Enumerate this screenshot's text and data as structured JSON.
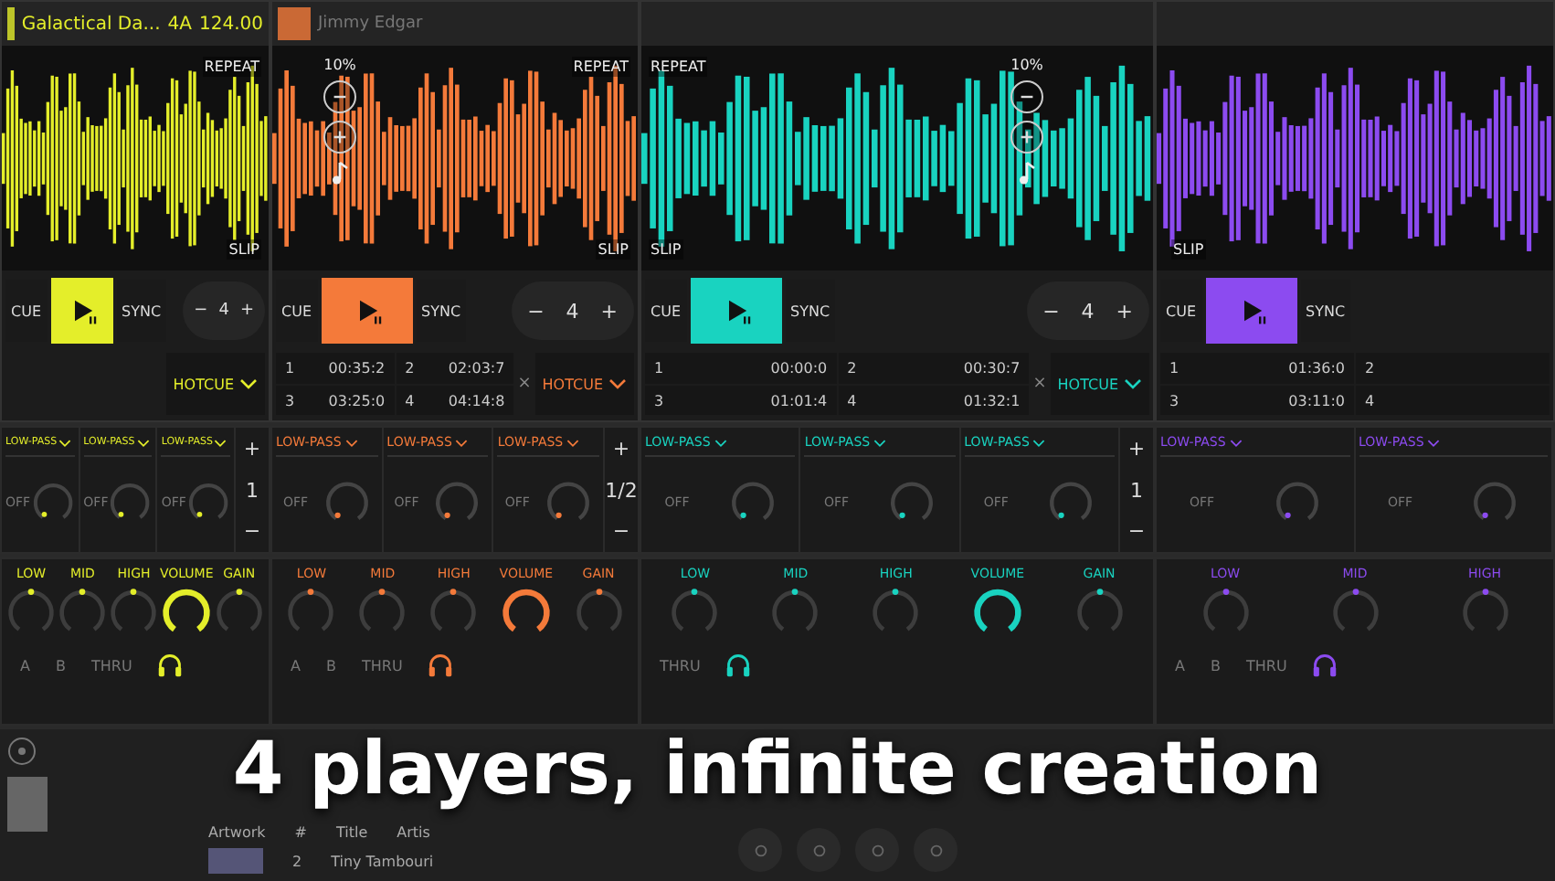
{
  "decks": [
    {
      "color": "#e4ee2a",
      "title": "Galactical Da...",
      "key": "4A",
      "bpm": "124.00",
      "repeat": "REPEAT",
      "slip": "SLIP",
      "cue": "CUE",
      "sync": "SYNC",
      "loop": {
        "minus": "−",
        "beats": "4",
        "plus": "+"
      },
      "hotcue": "HOTCUE"
    },
    {
      "color": "#f47a3a",
      "artist": "Jimmy Edgar",
      "pitch": "10%",
      "repeat": "REPEAT",
      "slip": "SLIP",
      "cue": "CUE",
      "sync": "SYNC",
      "loop": {
        "minus": "−",
        "beats": "4",
        "plus": "+"
      },
      "cues": [
        {
          "num": "1",
          "time": "00:35:2"
        },
        {
          "num": "2",
          "time": "02:03:7"
        },
        {
          "num": "3",
          "time": "03:25:0"
        },
        {
          "num": "4",
          "time": "04:14:8"
        }
      ],
      "clear": "×",
      "hotcue": "HOTCUE"
    },
    {
      "color": "#19d3c0",
      "pitch": "10%",
      "repeat": "REPEAT",
      "slip": "SLIP",
      "cue": "CUE",
      "sync": "SYNC",
      "loop": {
        "minus": "−",
        "beats": "4",
        "plus": "+"
      },
      "cues": [
        {
          "num": "1",
          "time": "00:00:0"
        },
        {
          "num": "2",
          "time": "00:30:7"
        },
        {
          "num": "3",
          "time": "01:01:4"
        },
        {
          "num": "4",
          "time": "01:32:1"
        }
      ],
      "clear": "×",
      "hotcue": "HOTCUE"
    },
    {
      "color": "#8c4bf0",
      "slip": "SLIP",
      "cue": "CUE",
      "sync": "SYNC",
      "cues": [
        {
          "num": "1",
          "time": "01:36:0"
        },
        {
          "num": "2"
        },
        {
          "num": "3",
          "time": "03:11:0"
        },
        {
          "num": "4"
        }
      ]
    }
  ],
  "effects": [
    {
      "units": [
        {
          "name": "LOW-PASS",
          "state": "OFF"
        },
        {
          "name": "LOW-PASS",
          "state": "OFF"
        },
        {
          "name": "LOW-PASS",
          "state": "OFF"
        }
      ],
      "stepper": {
        "plus": "+",
        "value": "1",
        "minus": "−"
      }
    },
    {
      "units": [
        {
          "name": "LOW-PASS",
          "state": "OFF"
        },
        {
          "name": "LOW-PASS",
          "state": "OFF"
        },
        {
          "name": "LOW-PASS",
          "state": "OFF"
        }
      ],
      "stepper": {
        "plus": "+",
        "value": "1/2",
        "minus": "−"
      }
    },
    {
      "units": [
        {
          "name": "LOW-PASS",
          "state": "OFF"
        },
        {
          "name": "LOW-PASS",
          "state": "OFF"
        },
        {
          "name": "LOW-PASS",
          "state": "OFF"
        }
      ],
      "stepper": {
        "plus": "+",
        "value": "1",
        "minus": "−"
      }
    },
    {
      "units": [
        {
          "name": "LOW-PASS",
          "state": "OFF"
        },
        {
          "name": "LOW-PASS",
          "state": "OFF"
        }
      ]
    }
  ],
  "mixer": [
    {
      "knobs": [
        "LOW",
        "MID",
        "HIGH",
        "VOLUME",
        "GAIN"
      ],
      "routes": [
        "A",
        "B",
        "THRU"
      ]
    },
    {
      "knobs": [
        "LOW",
        "MID",
        "HIGH",
        "VOLUME",
        "GAIN"
      ],
      "routes": [
        "A",
        "B",
        "THRU"
      ]
    },
    {
      "knobs": [
        "LOW",
        "MID",
        "HIGH",
        "VOLUME",
        "GAIN"
      ],
      "routes": [
        "THRU"
      ]
    },
    {
      "knobs": [
        "LOW",
        "MID",
        "HIGH"
      ],
      "routes": [
        "A",
        "B",
        "THRU"
      ]
    }
  ],
  "browser": {
    "columns": [
      "Artwork",
      "#",
      "Title",
      "Artis"
    ],
    "row": {
      "num": "2",
      "title": "Tiny Tambouri"
    }
  },
  "caption": "4 players, infinite creation"
}
